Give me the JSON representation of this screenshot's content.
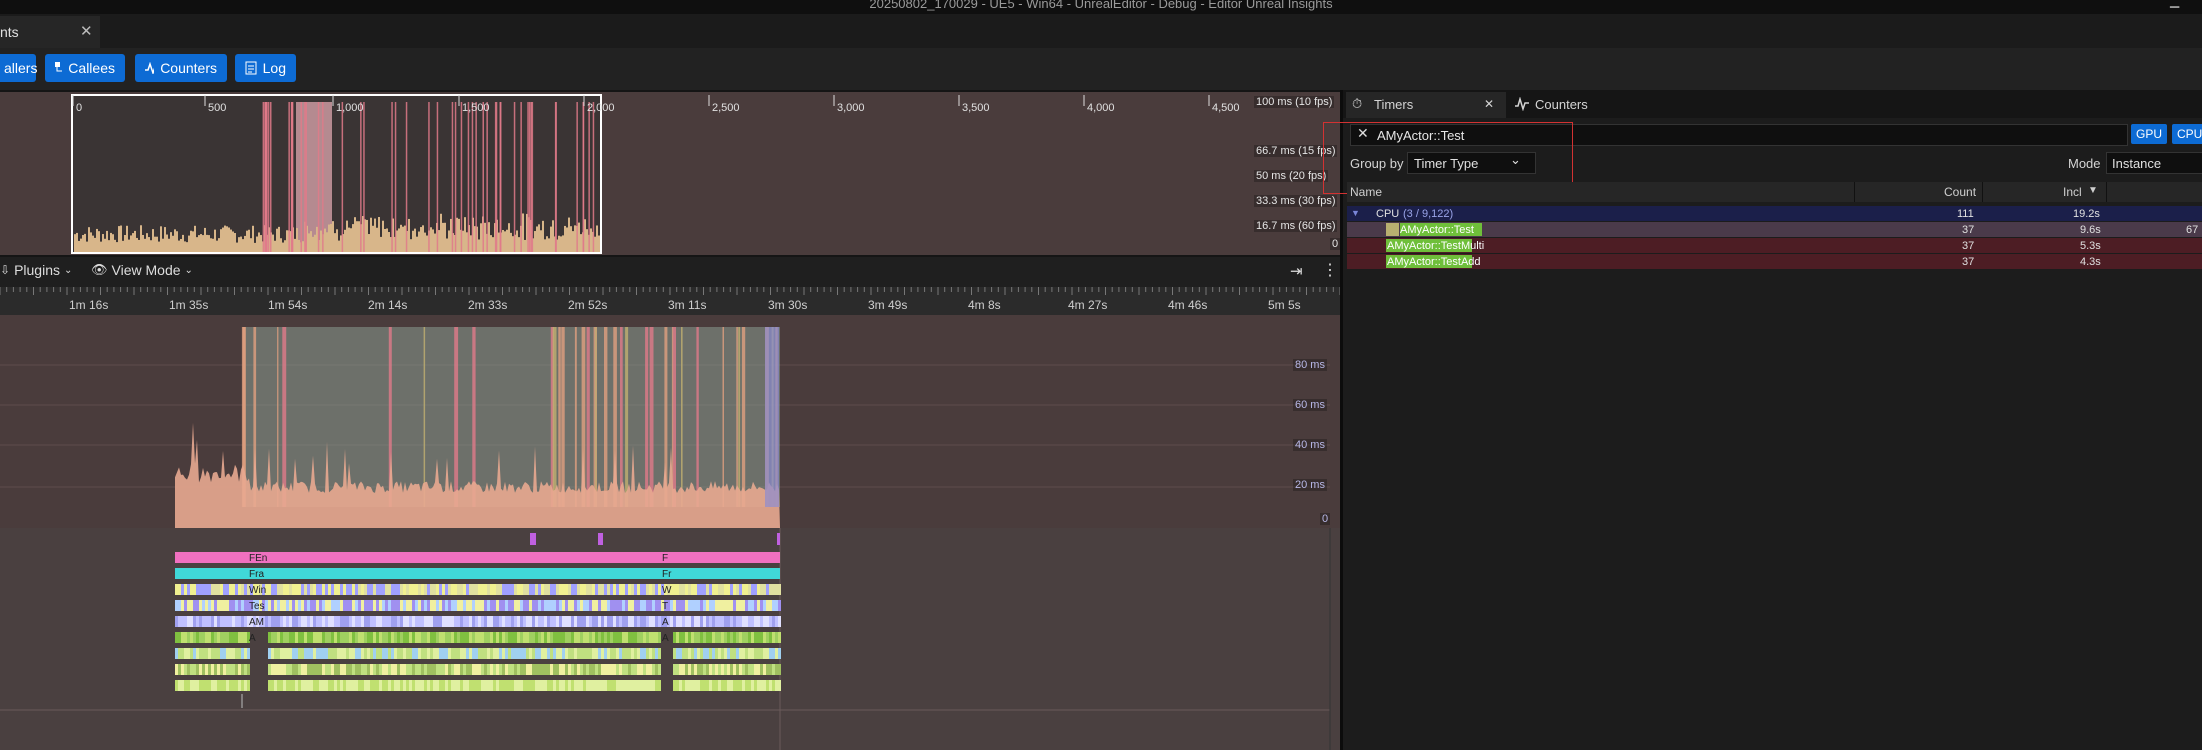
{
  "window": {
    "title": "20250802_170029 - UE5 - Win64 - UnrealEditor - Debug - Editor Unreal Insights"
  },
  "doc_tab": {
    "label": "nts",
    "close": "✕"
  },
  "toolbar": {
    "buttons": [
      {
        "label": "allers",
        "icon": "callers-icon"
      },
      {
        "label": "Callees",
        "icon": "callees-icon"
      },
      {
        "label": "Counters",
        "icon": "counters-icon"
      },
      {
        "label": "Log",
        "icon": "log-icon"
      }
    ]
  },
  "frames": {
    "ticks": [
      "0",
      "500",
      "1,000",
      "1,500",
      "2,000",
      "2,500",
      "3,000",
      "3,500",
      "4,000",
      "4,500"
    ],
    "fps_labels": [
      "100 ms (10 fps)",
      "66.7 ms (15 fps)",
      "50 ms (20 fps)",
      "33.3 ms (30 fps)",
      "16.7 ms (60 fps)",
      "0"
    ]
  },
  "timing": {
    "plugins_label": "Plugins",
    "viewmode_label": "View Mode",
    "ticks": [
      "1m 16s",
      "1m 35s",
      "1m 54s",
      "2m 14s",
      "2m 33s",
      "2m 52s",
      "3m 11s",
      "3m 30s",
      "3m 49s",
      "4m 8s",
      "4m 27s",
      "4m 46s",
      "5m 5s"
    ],
    "graph_labels": [
      "80 ms",
      "60 ms",
      "40 ms",
      "20 ms",
      "0"
    ],
    "track_labels_a": [
      "FEn",
      "Fra",
      "Win",
      "Tes",
      "AM",
      "A"
    ],
    "track_labels_b": [
      "F",
      "Fr",
      "W",
      "T",
      "A",
      "A"
    ]
  },
  "timers_panel": {
    "tabs": [
      {
        "label": "Timers",
        "icon": "timer-icon",
        "close": "✕"
      },
      {
        "label": "Counters",
        "icon": "counters-icon"
      }
    ],
    "search_value": "AMyActor::Test",
    "chips": [
      "GPU",
      "CPU"
    ],
    "group_by_label": "Group by",
    "group_by_value": "Timer Type",
    "mode_label": "Mode",
    "mode_value": "Instance",
    "columns": [
      "Name",
      "Count",
      "Incl"
    ],
    "rows": [
      {
        "name": "CPU",
        "extra": "(3 / 9,122)",
        "count": "111",
        "incl": "19.2s",
        "excl": ""
      },
      {
        "name": "AMyActor::Test",
        "extra": "",
        "count": "37",
        "incl": "9.6s",
        "excl": "67"
      },
      {
        "name": "AMyActor::TestMulti",
        "extra": "",
        "count": "37",
        "incl": "5.3s",
        "excl": ""
      },
      {
        "name": "AMyActor::TestAdd",
        "extra": "",
        "count": "37",
        "incl": "4.3s",
        "excl": ""
      }
    ]
  },
  "colors": {
    "accent_blue": "#0d6bd4",
    "frame_bg": "#4a3c3c",
    "frame_fill": "#d8b68a",
    "frame_spike": "#e07a8a",
    "selection_border": "#ffffff",
    "row_selected": "#4a3a4a",
    "row_cpu": "#1b1f4a",
    "row_timer": "#4d1d24",
    "timer_green": "#6fbf3a",
    "red_highlight": "#d23232"
  }
}
